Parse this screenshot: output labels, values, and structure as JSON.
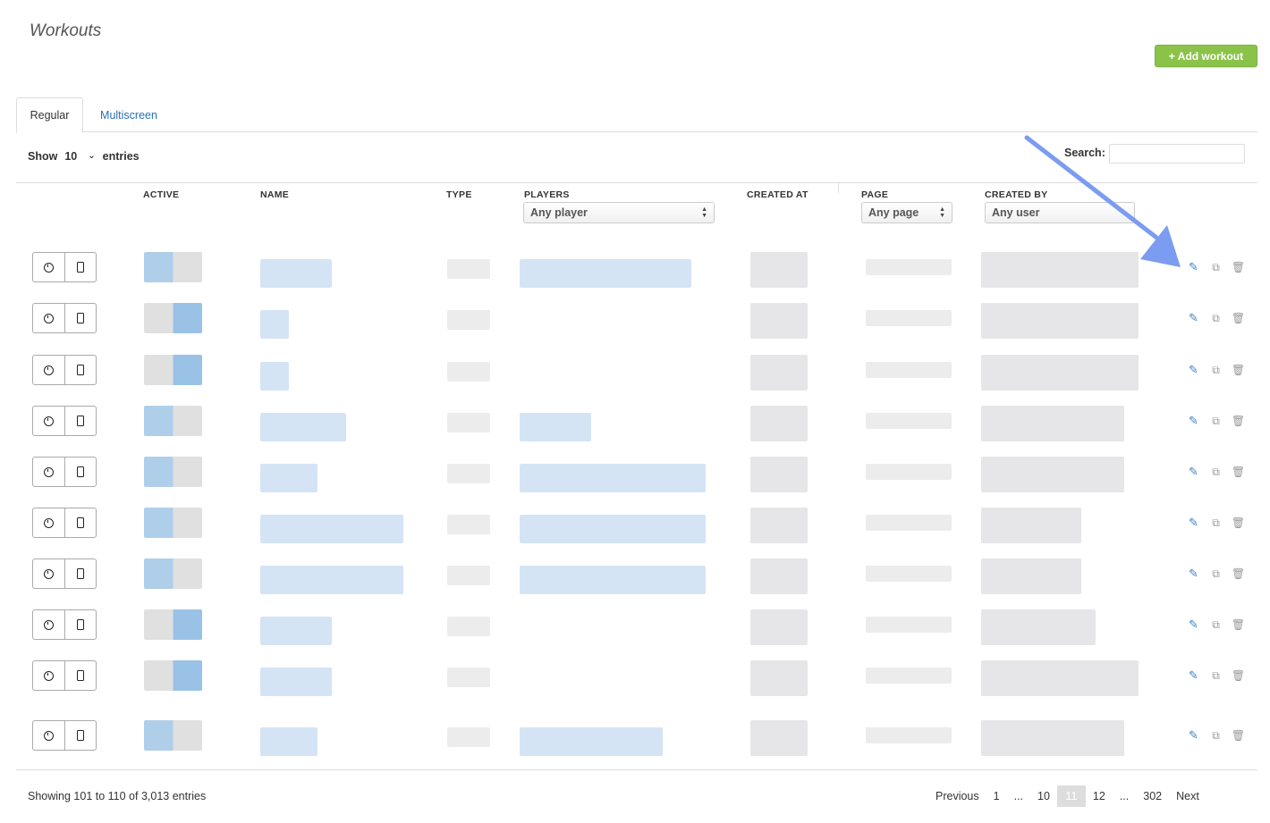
{
  "page": {
    "title": "Workouts"
  },
  "header": {
    "add_label": "+ Add workout"
  },
  "tabs": [
    {
      "label": "Regular",
      "active": true
    },
    {
      "label": "Multiscreen",
      "active": false
    }
  ],
  "length": {
    "show_label": "Show",
    "value": "10",
    "entries_label": "entries"
  },
  "search": {
    "label": "Search:",
    "value": ""
  },
  "columns": {
    "active": "ACTIVE",
    "name": "NAME",
    "type": "TYPE",
    "players": "PLAYERS",
    "created_at": "CREATED AT",
    "page": "PAGE",
    "created_by": "CREATED BY"
  },
  "filters": {
    "players": "Any player",
    "page": "Any page",
    "created_by": "Any user"
  },
  "icons": {
    "schedule": "clock-icon",
    "device": "tablet-icon",
    "edit": "pencil-icon",
    "duplicate": "copy-icon",
    "delete": "trash-icon"
  },
  "colors": {
    "accent_green": "#8bc34a",
    "link_blue": "#2a6fb5",
    "annotation_arrow": "#7b9cf0"
  },
  "rows_count_visible": 10,
  "footer": {
    "showing": "Showing 101 to 110 of 3,013 entries",
    "pagination": [
      "Previous",
      "1",
      "...",
      "10",
      "11",
      "12",
      "...",
      "302",
      "Next"
    ],
    "current_page": "11"
  }
}
